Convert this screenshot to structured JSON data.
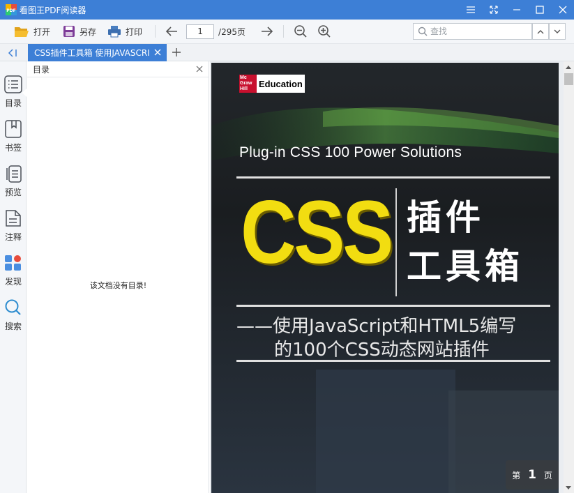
{
  "window": {
    "title": "看图王PDF阅读器",
    "logo_text": "PDF"
  },
  "toolbar": {
    "open_label": "打开",
    "save_as_label": "另存",
    "print_label": "打印",
    "current_page": "1",
    "total_pages": "/295页",
    "search_placeholder": "查找"
  },
  "tabs": {
    "active_tab_label": "CSS插件工具箱   使用JAVASCRI"
  },
  "rail": {
    "items": [
      {
        "label": "目录",
        "icon": "list-icon"
      },
      {
        "label": "书签",
        "icon": "bookmark-icon"
      },
      {
        "label": "预览",
        "icon": "preview-icon"
      },
      {
        "label": "注释",
        "icon": "annotation-icon"
      },
      {
        "label": "发现",
        "icon": "discover-icon"
      },
      {
        "label": "搜索",
        "icon": "search-icon"
      }
    ]
  },
  "toc": {
    "title": "目录",
    "empty_message": "该文档没有目录!"
  },
  "document": {
    "publisher_small": "Mc Graw Hill",
    "publisher_brand": "Education",
    "english_title": "Plug-in CSS 100 Power Solutions",
    "big_title": "CSS",
    "cn_title_line1": "插件",
    "cn_title_line2": "工具箱",
    "subtitle_line1": "——使用JavaScript和HTML5编写",
    "subtitle_line2": "的100个CSS动态网站插件"
  },
  "page_badge": {
    "prefix": "第",
    "number": "1",
    "suffix": "页"
  },
  "colors": {
    "accent": "#3d7fd6",
    "css_yellow": "#f2dd11"
  }
}
